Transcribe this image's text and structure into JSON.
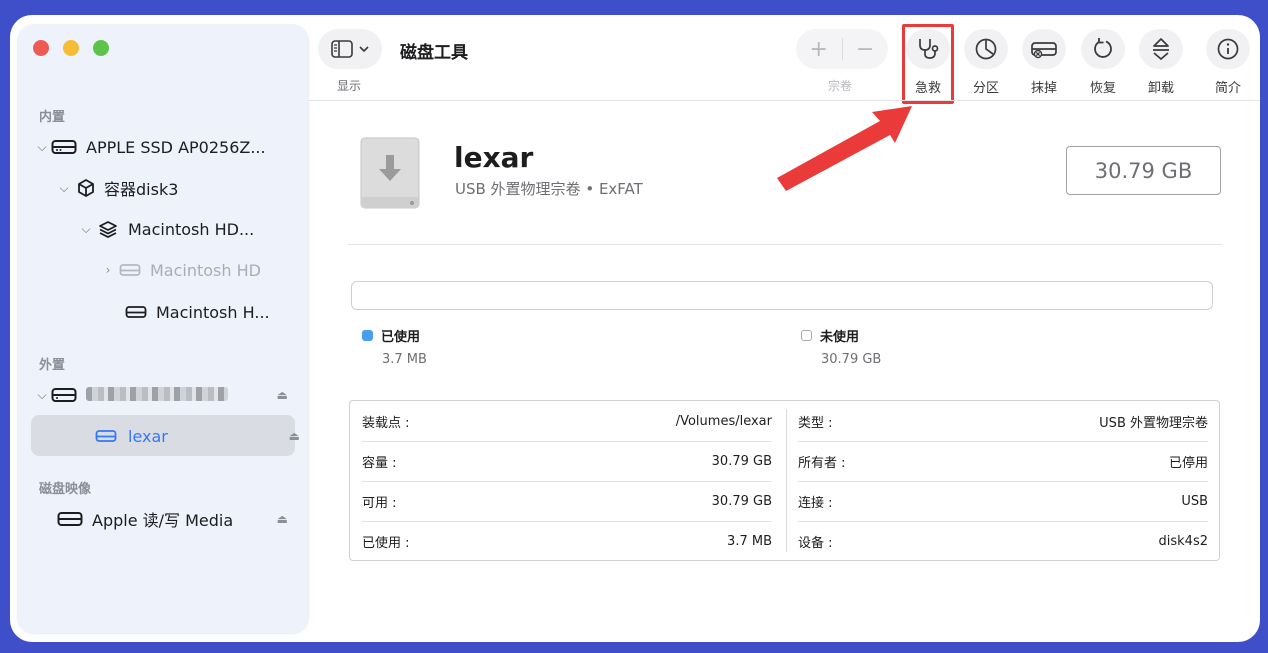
{
  "sidebar": {
    "sections": {
      "internal": "内置",
      "external": "外置",
      "images": "磁盘映像"
    },
    "items": [
      {
        "label": "APPLE SSD AP0256Z...",
        "icon": "internal-disk-icon"
      },
      {
        "label": "容器disk3",
        "icon": "container-icon"
      },
      {
        "label": "Macintosh HD...",
        "icon": "volume-stack-icon"
      },
      {
        "label": "Macintosh HD",
        "icon": "drive-icon"
      },
      {
        "label": "Macintosh H...",
        "icon": "drive-icon"
      },
      {
        "label": "lexar",
        "icon": "drive-icon"
      },
      {
        "label": "Apple 读/写 Media",
        "icon": "drive-icon"
      }
    ]
  },
  "toolbar": {
    "view_label": "显示",
    "title": "磁盘工具",
    "volume_label": "宗卷",
    "buttons": [
      {
        "label": "急救",
        "icon": "stethoscope-icon"
      },
      {
        "label": "分区",
        "icon": "pie-chart-icon"
      },
      {
        "label": "抹掉",
        "icon": "erase-disk-icon"
      },
      {
        "label": "恢复",
        "icon": "restore-icon"
      },
      {
        "label": "卸载",
        "icon": "unmount-icon"
      },
      {
        "label": "简介",
        "icon": "info-icon"
      }
    ]
  },
  "volume": {
    "name": "lexar",
    "description": "USB 外置物理宗卷 • ExFAT",
    "size": "30.79 GB",
    "used_fraction": 0.0001
  },
  "usage": {
    "used_label": "已使用",
    "used_value": "3.7 MB",
    "used_color": "#4a9cf0",
    "free_label": "未使用",
    "free_value": "30.79 GB"
  },
  "info": {
    "left": [
      {
        "k": "装载点 :",
        "v": "/Volumes/lexar"
      },
      {
        "k": "容量 :",
        "v": "30.79 GB"
      },
      {
        "k": "可用 :",
        "v": "30.79 GB"
      },
      {
        "k": "已使用 :",
        "v": "3.7 MB"
      }
    ],
    "right": [
      {
        "k": "类型 :",
        "v": "USB 外置物理宗卷"
      },
      {
        "k": "所有者 :",
        "v": "已停用"
      },
      {
        "k": "连接 :",
        "v": "USB"
      },
      {
        "k": "设备 :",
        "v": "disk4s2"
      }
    ]
  },
  "colors": {
    "highlight": "#ea3a3a",
    "accent": "#3478f6"
  }
}
